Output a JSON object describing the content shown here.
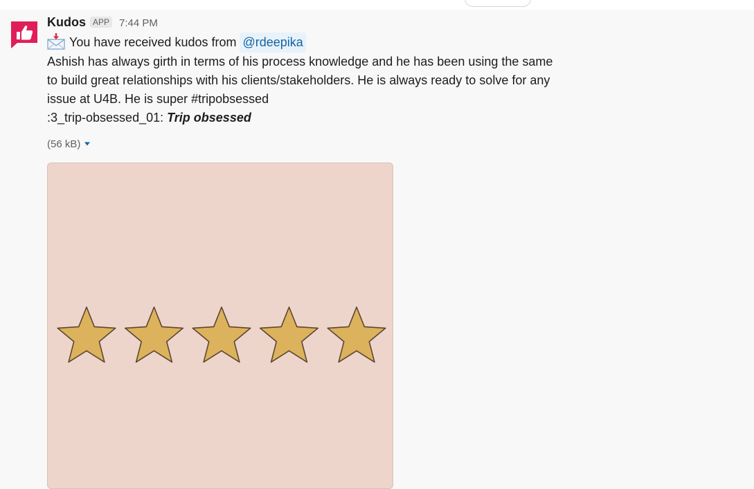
{
  "message": {
    "sender": "Kudos",
    "badge": "APP",
    "time": "7:44 PM",
    "kudos_text": "You have received kudos from",
    "mention": "@rdeepika",
    "body_lines": [
      "Ashish has always girth in terms of his process knowledge and he has been using the same",
      "to build great relationships with his clients/stakeholders. He is always ready to solve for any",
      "issue at U4B. He is super #tripobsessed"
    ],
    "emoji_code": ":3_trip-obsessed_01:",
    "emoji_label": "Trip obsessed",
    "file_size": "(56 kB)",
    "icons": {
      "avatar": "thumbs-up-icon",
      "envelope": "incoming-envelope-icon",
      "caret": "caret-down-icon",
      "star": "star-icon"
    },
    "colors": {
      "brand_red": "#e01e5a",
      "mention_bg": "#e8f2fa",
      "mention_text": "#1264a3",
      "image_bg": "#eed5cb",
      "star_fill": "#ddb25c"
    },
    "rating": 5
  }
}
